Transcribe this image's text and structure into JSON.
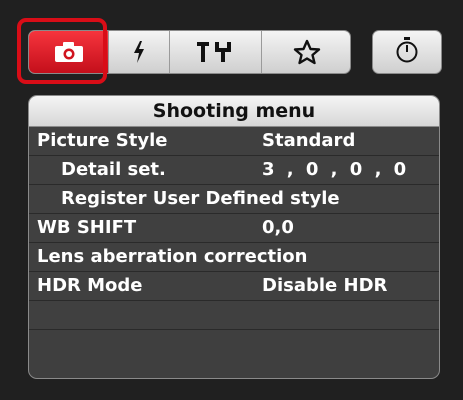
{
  "menu": {
    "title": "Shooting menu",
    "rows": [
      {
        "label": "Picture Style",
        "value": "Standard"
      },
      {
        "label": "Detail set.",
        "value": "3 , 0 , 0 , 0"
      },
      {
        "label": "Register User Defined style",
        "value": ""
      },
      {
        "label": "WB SHIFT",
        "value": "0,0"
      },
      {
        "label": "Lens aberration correction",
        "value": ""
      },
      {
        "label": "HDR Mode",
        "value": "Disable HDR"
      },
      {
        "label": "",
        "value": ""
      }
    ]
  },
  "tabs": [
    {
      "icon": "camera-icon",
      "active": true
    },
    {
      "icon": "flash-icon",
      "active": false
    },
    {
      "icon": "tools-icon",
      "active": false
    },
    {
      "icon": "star-icon",
      "active": false
    },
    {
      "icon": "timer-icon",
      "active": false
    }
  ],
  "colors": {
    "active_tab": "#e1202a",
    "highlight_border": "#d90d17",
    "panel_background": "#202020",
    "menu_background": "#404040"
  }
}
